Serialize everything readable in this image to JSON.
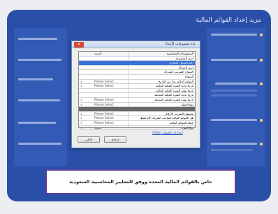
{
  "background": {
    "heading": "مزيد إعداد القوائم المالية"
  },
  "dialog": {
    "title": "بناء مجموعات الإعداد",
    "close_label": "✕",
    "header_col_name": "المجموعات المحاسبية",
    "header_col_value": "القيمة",
    "rows": [
      {
        "name": "اسم المجموعة",
        "mid": "",
        "left": "",
        "style": "normal"
      },
      {
        "name": "رقم السجل التجاري",
        "mid": "",
        "left": "",
        "style": "sel"
      },
      {
        "name": "اسم الشركة",
        "mid": "",
        "left": "",
        "style": "normal"
      },
      {
        "name": "العنوان الضريبي للشركة",
        "mid": "",
        "left": "",
        "style": "normal"
      },
      {
        "name": "المفتاح",
        "mid": "",
        "left": "",
        "style": "normal"
      },
      {
        "name": "القوائم المالية تبدأ من التاريخ",
        "mid": "Please Select",
        "left": "∨",
        "style": "normal"
      },
      {
        "name": "تاريخ بداية الفترة المالية الحالية",
        "mid": "Please Select",
        "left": "∨",
        "style": "normal"
      },
      {
        "name": "تاريخ نهاية الفترة المالية الحالية",
        "mid": "",
        "left": "",
        "style": "normal"
      },
      {
        "name": "تاريخ بداية الفترة المالية السابقة",
        "mid": "",
        "left": "",
        "style": "normal"
      },
      {
        "name": "تاريخ نهاية الفترة المالية السابقة",
        "mid": "Please Select",
        "left": "∨",
        "style": "normal"
      },
      {
        "name": "نوع العملة",
        "mid": "Please Select",
        "left": "∨",
        "style": "normal"
      },
      {
        "name": "",
        "mid": "",
        "left": "",
        "style": "dark"
      },
      {
        "name": "مستوى التقريب الأرقام",
        "mid": "Please Select",
        "left": "∨",
        "style": "normal"
      },
      {
        "name": "هل القوائم المالية لصاحب الشركة الأم فقط",
        "mid": "Please Select",
        "left": "∨",
        "style": "normal"
      },
      {
        "name": "عملة القوائم المالية",
        "mid": "Please Select",
        "left": "∨",
        "style": "normal"
      },
      {
        "name": "نوع الفترة",
        "mid": "سنوية",
        "left": "∨",
        "style": "normal"
      }
    ],
    "link_text": "إعدادات الحقول (Tabs)",
    "btn_back": "إرجاع",
    "btn_next": "التالي"
  },
  "caption": {
    "text": "خاص بالقوائم المالية المعدة ووفق للمعايير المحاسبية السعودية"
  },
  "colors": {
    "screen": "#2a4fa8",
    "selected_row": "#3a73d6",
    "caption_border": "#5a3f98"
  }
}
